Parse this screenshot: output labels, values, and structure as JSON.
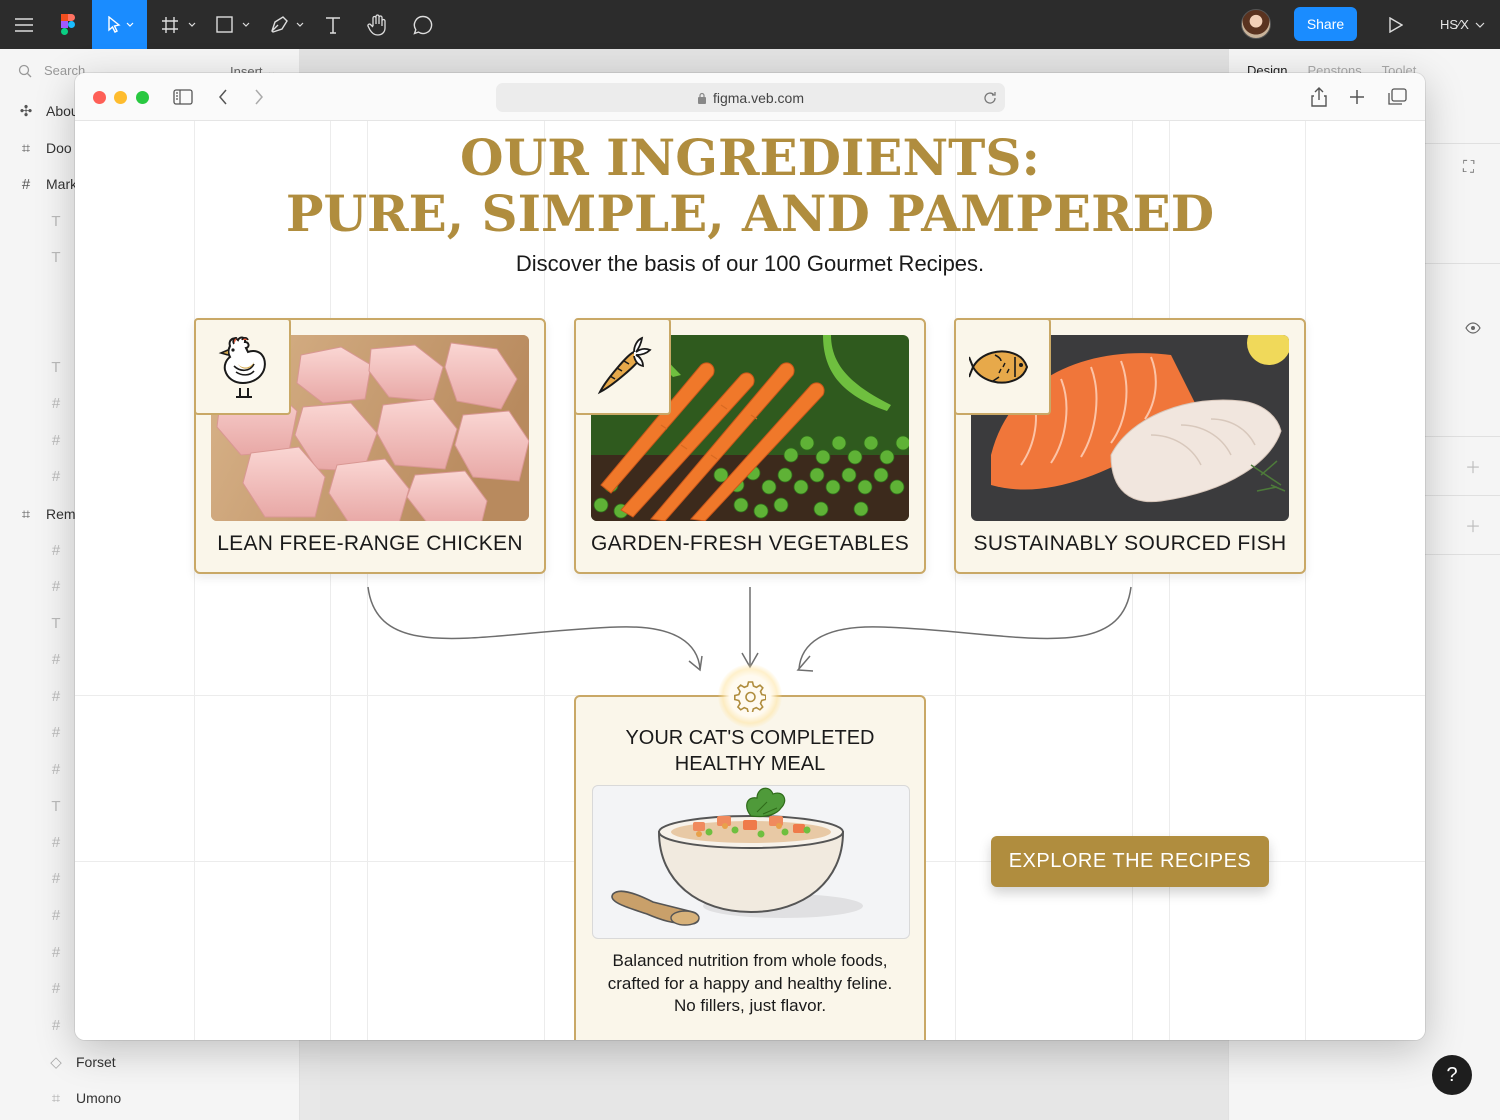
{
  "topbar": {
    "share_label": "Share",
    "zoom_label": "HS⁄X"
  },
  "left_panel": {
    "search_placeholder": "Search",
    "insert_label": "Insert",
    "items": [
      {
        "label": "Abou",
        "icon": "component-icon"
      },
      {
        "label": "Doo",
        "icon": "frame-icon"
      },
      {
        "label": "Mark",
        "icon": "hash-icon"
      },
      {
        "label": "Rem",
        "icon": "frame-icon"
      },
      {
        "label": "Forset",
        "icon": "diamond-icon"
      },
      {
        "label": "Umono",
        "icon": "frame-icon"
      }
    ]
  },
  "right_panel": {
    "tabs": [
      "Design",
      "Penstons",
      "Toolet"
    ]
  },
  "browser": {
    "url": "figma.veb.com"
  },
  "page": {
    "title_line1": "OUR INGREDIENTS:",
    "title_line2": "PURE, SIMPLE, AND PAMPERED",
    "subtitle": "Discover the basis of our 100 Gourmet Recipes.",
    "cards": [
      {
        "label": "LEAN FREE-RANGE CHICKEN",
        "icon": "chicken-icon"
      },
      {
        "label": "GARDEN-FRESH VEGETABLES",
        "icon": "carrot-icon"
      },
      {
        "label": "SUSTAINABLY SOURCED FISH",
        "icon": "fish-icon"
      }
    ],
    "result": {
      "title_line1": "YOUR CAT'S COMPLETED",
      "title_line2": "HEALTHY MEAL",
      "desc_line1": "Balanced nutrition from whole foods,",
      "desc_line2": "crafted for a happy and healthy feline.",
      "desc_line3": "No fillers, just flavor."
    },
    "cta_label": "EXPLORE THE RECIPES",
    "colors": {
      "gold": "#b08d3e",
      "card_bg": "#faf6ea",
      "figma_blue": "#1a8cff"
    }
  }
}
